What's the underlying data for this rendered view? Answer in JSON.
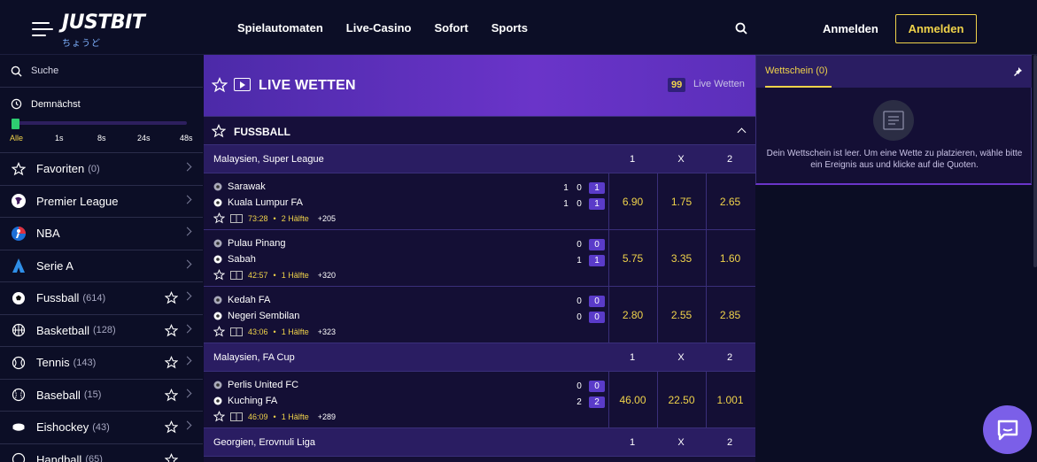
{
  "header": {
    "logo": "JUSTBIT",
    "logo_sub": "ちょうど",
    "nav": [
      "Spielautomaten",
      "Live-Casino",
      "Sofort",
      "Sports"
    ],
    "login": "Anmelden",
    "register": "Anmelden"
  },
  "sidebar": {
    "search_placeholder": "Suche",
    "upcoming": {
      "title": "Demnächst",
      "ticks": [
        "Alle",
        "1s",
        "8s",
        "24s",
        "48s"
      ]
    },
    "items": [
      {
        "label": "Favoriten",
        "count": "(0)",
        "icon": "star-icon"
      },
      {
        "label": "Premier League",
        "count": "",
        "icon": "premier-league-icon"
      },
      {
        "label": "NBA",
        "count": "",
        "icon": "nba-icon"
      },
      {
        "label": "Serie A",
        "count": "",
        "icon": "serie-a-icon"
      },
      {
        "label": "Fussball",
        "count": "(614)",
        "icon": "soccer-ball-icon"
      },
      {
        "label": "Basketball",
        "count": "(128)",
        "icon": "basketball-icon"
      },
      {
        "label": "Tennis",
        "count": "(143)",
        "icon": "tennis-ball-icon"
      },
      {
        "label": "Baseball",
        "count": "(15)",
        "icon": "baseball-icon"
      },
      {
        "label": "Eishockey",
        "count": "(43)",
        "icon": "hockey-puck-icon"
      },
      {
        "label": "Handball",
        "count": "(65)",
        "icon": "handball-icon"
      }
    ]
  },
  "main": {
    "live_title": "LIVE WETTEN",
    "live_count": "99",
    "live_count_label": "Live Wetten",
    "sport_title": "FUSSBALL",
    "odds_headers": [
      "1",
      "X",
      "2"
    ],
    "leagues": [
      {
        "name": "Malaysien, Super League",
        "matches": [
          {
            "home": "Sarawak",
            "away": "Kuala Lumpur FA",
            "home_scores": [
              "1",
              "0",
              "1"
            ],
            "away_scores": [
              "1",
              "0",
              "1"
            ],
            "time": "73:28",
            "period": "2 Hälfte",
            "more": "+205",
            "odds": [
              "6.90",
              "1.75",
              "2.65"
            ]
          },
          {
            "home": "Pulau Pinang",
            "away": "Sabah",
            "home_scores": [
              "0",
              "0"
            ],
            "away_scores": [
              "1",
              "1"
            ],
            "time": "42:57",
            "period": "1 Hälfte",
            "more": "+320",
            "odds": [
              "5.75",
              "3.35",
              "1.60"
            ]
          },
          {
            "home": "Kedah FA",
            "away": "Negeri Sembilan",
            "home_scores": [
              "0",
              "0"
            ],
            "away_scores": [
              "0",
              "0"
            ],
            "time": "43:06",
            "period": "1 Hälfte",
            "more": "+323",
            "odds": [
              "2.80",
              "2.55",
              "2.85"
            ]
          }
        ]
      },
      {
        "name": "Malaysien, FA Cup",
        "matches": [
          {
            "home": "Perlis United FC",
            "away": "Kuching FA",
            "home_scores": [
              "0",
              "0"
            ],
            "away_scores": [
              "2",
              "2"
            ],
            "time": "46:09",
            "period": "1 Hälfte",
            "more": "+289",
            "odds": [
              "46.00",
              "22.50",
              "1.001"
            ]
          }
        ]
      },
      {
        "name": "Georgien, Erovnuli Liga",
        "matches": []
      }
    ]
  },
  "betslip": {
    "tab": "Wettschein (0)",
    "empty_text": "Dein Wettschein ist leer. Um eine Wette zu platzieren, wähle bitte ein Ereignis aus und klicke auf die Quoten."
  },
  "colors": {
    "accent": "#f0d34a",
    "purple": "#6a34c9",
    "bg": "#0b0d24"
  }
}
